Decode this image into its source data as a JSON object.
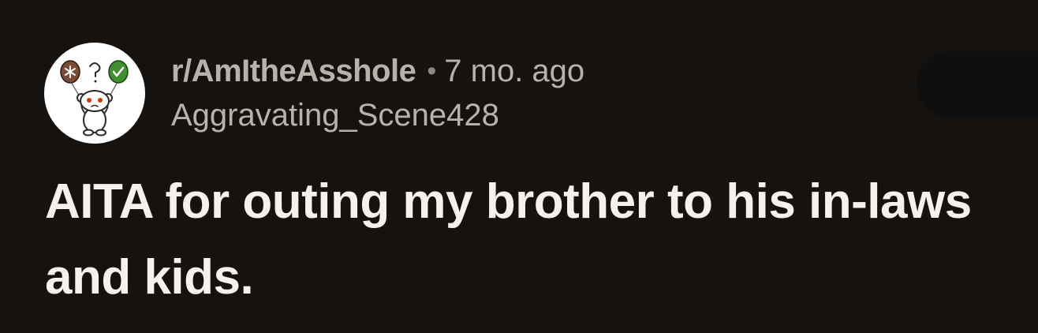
{
  "post": {
    "subreddit": "r/AmItheAsshole",
    "separator": "•",
    "time_ago": "7 mo. ago",
    "author": "Aggravating_Scene428",
    "title": "AITA for outing my brother to his in-laws and kids."
  },
  "colors": {
    "background": "#161210",
    "meta_text": "#b9b2aa",
    "title_text": "#f5f1ec",
    "avatar_bg": "#ffffff",
    "balloon_brown": "#7a4a35",
    "balloon_green": "#3f8f2e"
  },
  "icons": {
    "avatar": "snoo-with-balloons-icon",
    "balloon_left": "asterisk-balloon-icon",
    "balloon_right": "checkmark-balloon-icon"
  }
}
